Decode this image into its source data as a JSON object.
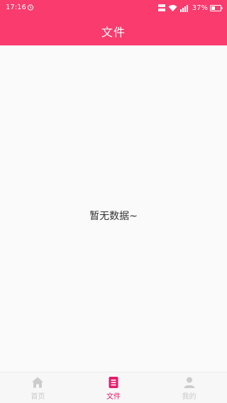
{
  "status": {
    "time": "17:16",
    "battery": "37%"
  },
  "header": {
    "title": "文件"
  },
  "main": {
    "empty_message": "暂无数据~"
  },
  "tabs": [
    {
      "label": "首页",
      "icon": "home-icon",
      "active": false
    },
    {
      "label": "文件",
      "icon": "file-icon",
      "active": true
    },
    {
      "label": "我的",
      "icon": "user-icon",
      "active": false
    }
  ],
  "colors": {
    "header_bg": "#f93b6d",
    "active_tab": "#e51c6b",
    "inactive_tab": "#c9c9c9"
  }
}
